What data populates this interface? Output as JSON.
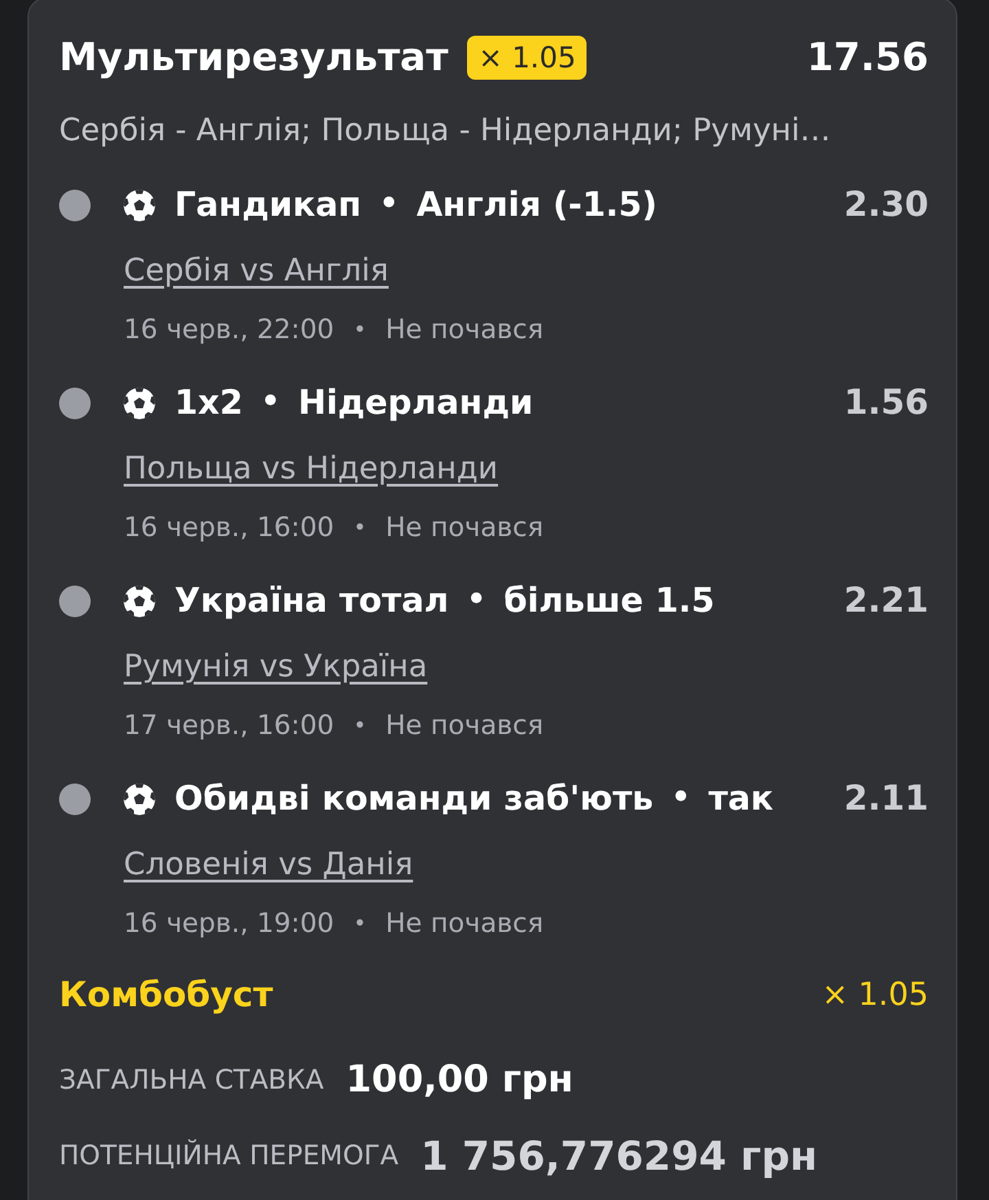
{
  "bet": {
    "title": "Мультирезультат",
    "boost_badge": "× 1.05",
    "total_odds": "17.56",
    "events_summary": "Сербія - Англія; Польща - Нідерланди; Румуні…"
  },
  "selections": [
    {
      "kind": "football",
      "market": "Гандикап",
      "separator": "•",
      "outcome": "Англія (-1.5)",
      "odds": "2.30",
      "match": "Сербія vs Англія",
      "date": "16 черв., 22:00",
      "status_separator": "•",
      "status": "Не почався"
    },
    {
      "kind": "football",
      "market": "1x2",
      "separator": "•",
      "outcome": "Нідерланди",
      "odds": "1.56",
      "match": "Польща vs Нідерланди",
      "date": "16 черв., 16:00",
      "status_separator": "•",
      "status": "Не почався"
    },
    {
      "kind": "football",
      "market": "Україна тотал",
      "separator": "•",
      "outcome": "більше 1.5",
      "odds": "2.21",
      "match": "Румунія vs Україна",
      "date": "17 черв., 16:00",
      "status_separator": "•",
      "status": "Не почався"
    },
    {
      "kind": "football",
      "market": "Обидві команди заб'ють",
      "separator": "•",
      "outcome": "так",
      "odds": "2.11",
      "match": "Словенія vs Данія",
      "date": "16 черв., 19:00",
      "status_separator": "•",
      "status": "Не почався"
    }
  ],
  "combo_boost": {
    "label": "Комбобуст",
    "multiplier": "× 1.05"
  },
  "totals": [
    {
      "kind": "stake",
      "label": "ЗАГАЛЬНА СТАВКА",
      "value": "100,00 грн"
    },
    {
      "kind": "payout",
      "label": "ПОТЕНЦІЙНА ПЕРЕМОГА",
      "value": "1 756,776294 грн"
    }
  ]
}
